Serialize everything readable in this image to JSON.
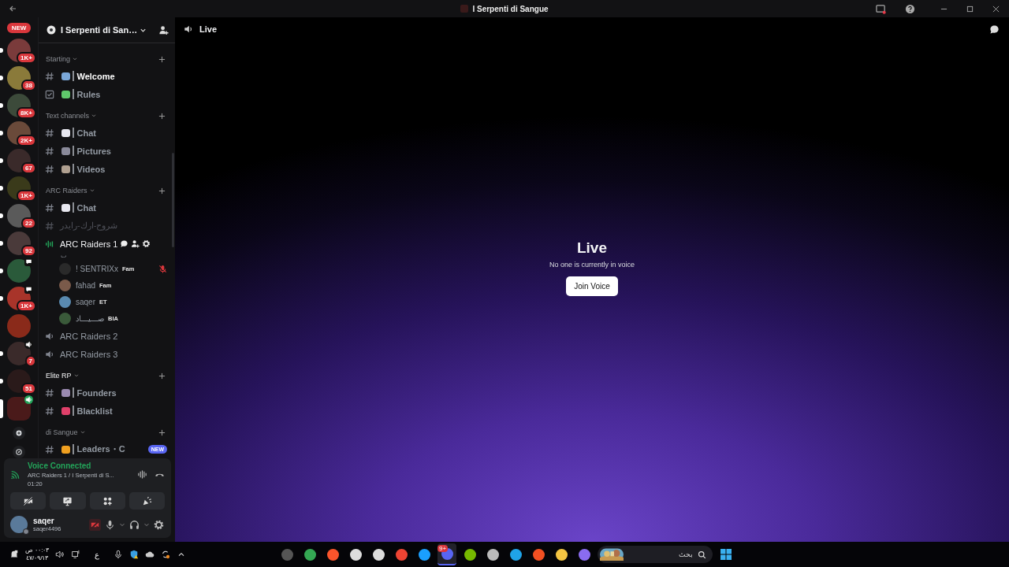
{
  "window": {
    "title": "I Serpenti di Sangue"
  },
  "rail": {
    "new_label": "NEW",
    "servers": [
      {
        "kind": "plain",
        "badge": "1K+",
        "unread": true,
        "selected": false,
        "color": "#7a3b3b"
      },
      {
        "kind": "plain",
        "badge": "38",
        "unread": true,
        "selected": false,
        "color": "#8a7a3a"
      },
      {
        "kind": "plain",
        "badge": "8K+",
        "unread": true,
        "selected": false,
        "color": "#3c4a3a"
      },
      {
        "kind": "plain",
        "badge": "2K+",
        "unread": true,
        "selected": false,
        "color": "#6a4a3a"
      },
      {
        "kind": "plain",
        "badge": "67",
        "unread": true,
        "selected": false,
        "color": "#3a2a2a"
      },
      {
        "kind": "plain",
        "badge": "1K+",
        "unread": true,
        "selected": false,
        "color": "#3a3a1a"
      },
      {
        "kind": "plain",
        "badge": "22",
        "unread": true,
        "selected": false,
        "color": "#5a5a5a"
      },
      {
        "kind": "plain",
        "badge": "92",
        "unread": true,
        "selected": false,
        "color": "#4a3a3a"
      },
      {
        "kind": "chat",
        "unread": true,
        "selected": false,
        "color": "#2a5a3a"
      },
      {
        "kind": "chat",
        "badge": "1K+",
        "unread": true,
        "selected": false,
        "color": "#a8342a"
      },
      {
        "kind": "plain",
        "unread": false,
        "selected": false,
        "color": "#8a2a1a"
      },
      {
        "kind": "voice",
        "badge": "7",
        "unread": true,
        "selected": false,
        "color": "#3a2a2a"
      },
      {
        "kind": "plain",
        "badge": "51",
        "unread": true,
        "selected": false,
        "color": "#2a1a1a"
      },
      {
        "kind": "voice_live",
        "unread": false,
        "selected": true,
        "color": "#4a1a1a"
      }
    ]
  },
  "server": {
    "name": "I Serpenti di San…"
  },
  "categories": [
    {
      "name": "Starting",
      "unread": false,
      "channels": [
        {
          "kind": "text",
          "name": "Welcome",
          "selected": false,
          "unread": true,
          "muted": false,
          "color": "#7aa7d8"
        },
        {
          "kind": "rules",
          "name": "Rules",
          "selected": false,
          "unread": false,
          "muted": false,
          "color": "#5fc86b"
        }
      ]
    },
    {
      "name": "Text channels",
      "unread": false,
      "channels": [
        {
          "kind": "text",
          "name": "Chat",
          "selected": false,
          "unread": false,
          "muted": false,
          "color": "#e8e8f0"
        },
        {
          "kind": "text",
          "name": "Pictures",
          "selected": false,
          "unread": false,
          "muted": false,
          "color": "#8a8a9a"
        },
        {
          "kind": "text",
          "name": "Videos",
          "selected": false,
          "unread": false,
          "muted": false,
          "color": "#b0a090"
        }
      ]
    },
    {
      "name": "ARC Raiders",
      "unread": false,
      "channels": [
        {
          "kind": "text",
          "name": "Chat",
          "selected": false,
          "unread": false,
          "muted": false,
          "color": "#e8e8f0"
        },
        {
          "kind": "text",
          "name": "شروح-ارك-رايدر",
          "selected": false,
          "unread": false,
          "muted": true
        },
        {
          "kind": "voice",
          "name": "ARC Raiders 1",
          "selected": true,
          "unread": false,
          "muted": false,
          "status": "ٮ",
          "users": [
            {
              "name": "! SENTRIXx",
              "tag": "Fam",
              "muted": true,
              "color": "#2a2a2a"
            },
            {
              "name": "fahad",
              "tag": "Fam",
              "muted": false,
              "color": "#7a5a4a"
            },
            {
              "name": "saqer",
              "tag": "ET",
              "muted": false,
              "color": "#5a8ab0"
            },
            {
              "name": "صـــيـــاد",
              "tag": "BIA",
              "muted": false,
              "color": "#3a5a3a"
            }
          ]
        },
        {
          "kind": "voice",
          "name": "ARC Raiders 2",
          "selected": false,
          "unread": false,
          "muted": false
        },
        {
          "kind": "voice",
          "name": "ARC Raiders 3",
          "selected": false,
          "unread": false,
          "muted": false
        }
      ]
    },
    {
      "name": "Elite RP",
      "unread": true,
      "channels": [
        {
          "kind": "text",
          "name": "Founders",
          "selected": false,
          "unread": false,
          "muted": false,
          "color": "#9a8ab0"
        },
        {
          "kind": "text",
          "name": "Blacklist",
          "selected": false,
          "unread": false,
          "muted": false,
          "color": "#e0406a"
        }
      ]
    },
    {
      "name": "di Sangue",
      "unread": false,
      "channels": [
        {
          "kind": "text",
          "name": "Leaders・C",
          "selected": false,
          "unread": false,
          "muted": false,
          "color": "#f0a020",
          "badge": "NEW"
        }
      ]
    }
  ],
  "voice_panel": {
    "status": "Voice Connected",
    "channel": "ARC Raiders 1 / I Serpenti di S...",
    "time": "01:20"
  },
  "user": {
    "name": "saqer",
    "handle": "saqer4496",
    "camera_off": true
  },
  "main": {
    "header": "Live",
    "title": "Live",
    "subtitle": "No one is currently in voice",
    "button": "Join Voice"
  },
  "taskbar": {
    "time": "٠٠:٠٣ ص",
    "date": "٤٧/٠٩/١٣",
    "language": "ع",
    "search_placeholder": "بحث",
    "apps": [
      {
        "color": "#555555",
        "active": false
      },
      {
        "color": "#34a853",
        "active": false
      },
      {
        "color": "#fb542b",
        "active": false
      },
      {
        "color": "#dddddd",
        "active": false
      },
      {
        "color": "#dddddd",
        "active": false
      },
      {
        "color": "#ee4433",
        "active": false
      },
      {
        "color": "#1a9fff",
        "active": false
      },
      {
        "color": "#5865f2",
        "active": true,
        "badge": "9+"
      },
      {
        "color": "#76b900",
        "active": false
      },
      {
        "color": "#bbbbbb",
        "active": false
      },
      {
        "color": "#1fa3e8",
        "active": false
      },
      {
        "color": "#f25022",
        "active": false
      },
      {
        "color": "#f4c542",
        "active": false
      },
      {
        "color": "#8a6cf0",
        "active": false
      }
    ]
  }
}
